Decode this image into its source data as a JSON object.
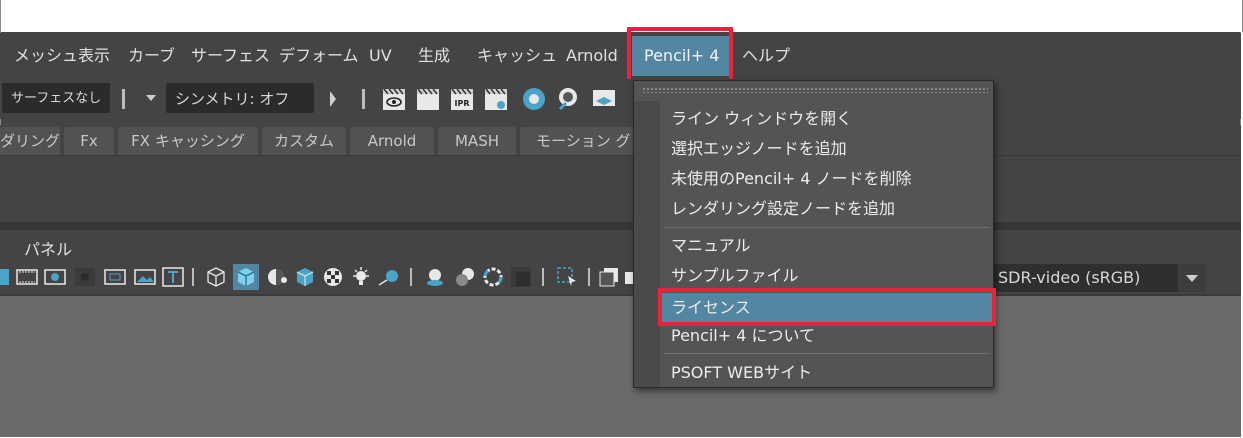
{
  "menubar": {
    "items": [
      "メッシュ表示",
      "カーブ",
      "サーフェス",
      "デフォーム",
      "UV",
      "生成",
      "キャッシュ",
      "Arnold",
      "Pencil+ 4",
      "ヘルプ"
    ]
  },
  "toolbar": {
    "surface_field": "サーフェスなし",
    "symmetry_field": "シンメトリ: オフ"
  },
  "shelf": {
    "tabs": [
      "ダリング",
      "Fx",
      "FX キャッシング",
      "カスタム",
      "Arnold",
      "MASH",
      "モーション グラ"
    ]
  },
  "panel": {
    "menu_label": "パネル",
    "color_space": "SDR-video (sRGB)"
  },
  "dropdown": {
    "items": [
      "ライン ウィンドウを開く",
      "選択エッジノードを追加",
      "未使用のPencil+ 4 ノードを削除",
      "レンダリング設定ノードを追加",
      "マニュアル",
      "サンプルファイル",
      "ライセンス",
      "Pencil+ 4 について",
      "PSOFT WEBサイト"
    ]
  },
  "colors": {
    "highlight_border": "#e8233a",
    "active_menu": "#5386a3",
    "background": "#444444"
  }
}
